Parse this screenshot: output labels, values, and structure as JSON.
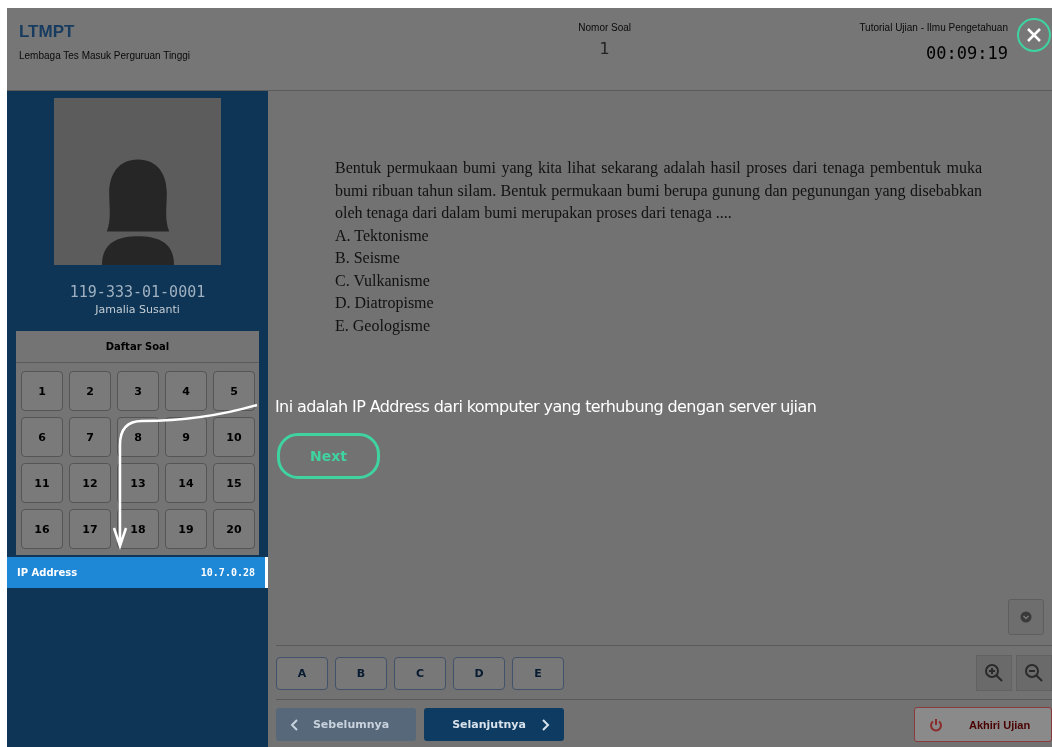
{
  "header": {
    "logo": "LTMPT",
    "subtitle": "Lembaga Tes Masuk Perguruan Tinggi",
    "question_label": "Nomor Soal",
    "question_number": "1",
    "exam_title": "Tutorial Ujian - Ilmu Pengetahuan",
    "timer": "00:09:19"
  },
  "candidate": {
    "id": "119-333-01-0001",
    "name": "Jamalia Susanti"
  },
  "question_list": {
    "title": "Daftar Soal",
    "numbers": [
      "1",
      "2",
      "3",
      "4",
      "5",
      "6",
      "7",
      "8",
      "9",
      "10",
      "11",
      "12",
      "13",
      "14",
      "15",
      "16",
      "17",
      "18",
      "19",
      "20"
    ]
  },
  "ip": {
    "label": "IP Address",
    "value": "10.7.0.28"
  },
  "question": {
    "text": "Bentuk permukaan bumi yang kita lihat sekarang adalah hasil proses dari tenaga pembentuk muka bumi ribuan tahun silam. Bentuk permukaan bumi berupa gunung dan pegunungan yang disebabkan oleh tenaga dari dalam bumi merupakan proses dari tenaga ....",
    "options": [
      "A. Tektonisme",
      "B. Seisme",
      "C. Vulkanisme",
      "D. Diatropisme",
      "E. Geologisme"
    ]
  },
  "answer_buttons": [
    "A",
    "B",
    "C",
    "D",
    "E"
  ],
  "nav": [
    {
      "label": "Sebelumnya",
      "kind": "prev",
      "disabled": true
    },
    {
      "label": "Selanjutnya",
      "kind": "next",
      "disabled": false
    }
  ],
  "end_button": {
    "label": "Akhiri Ujian"
  },
  "tour": {
    "text": "Ini adalah IP Address dari komputer yang terhubung dengan server ujian",
    "next": "Next"
  }
}
